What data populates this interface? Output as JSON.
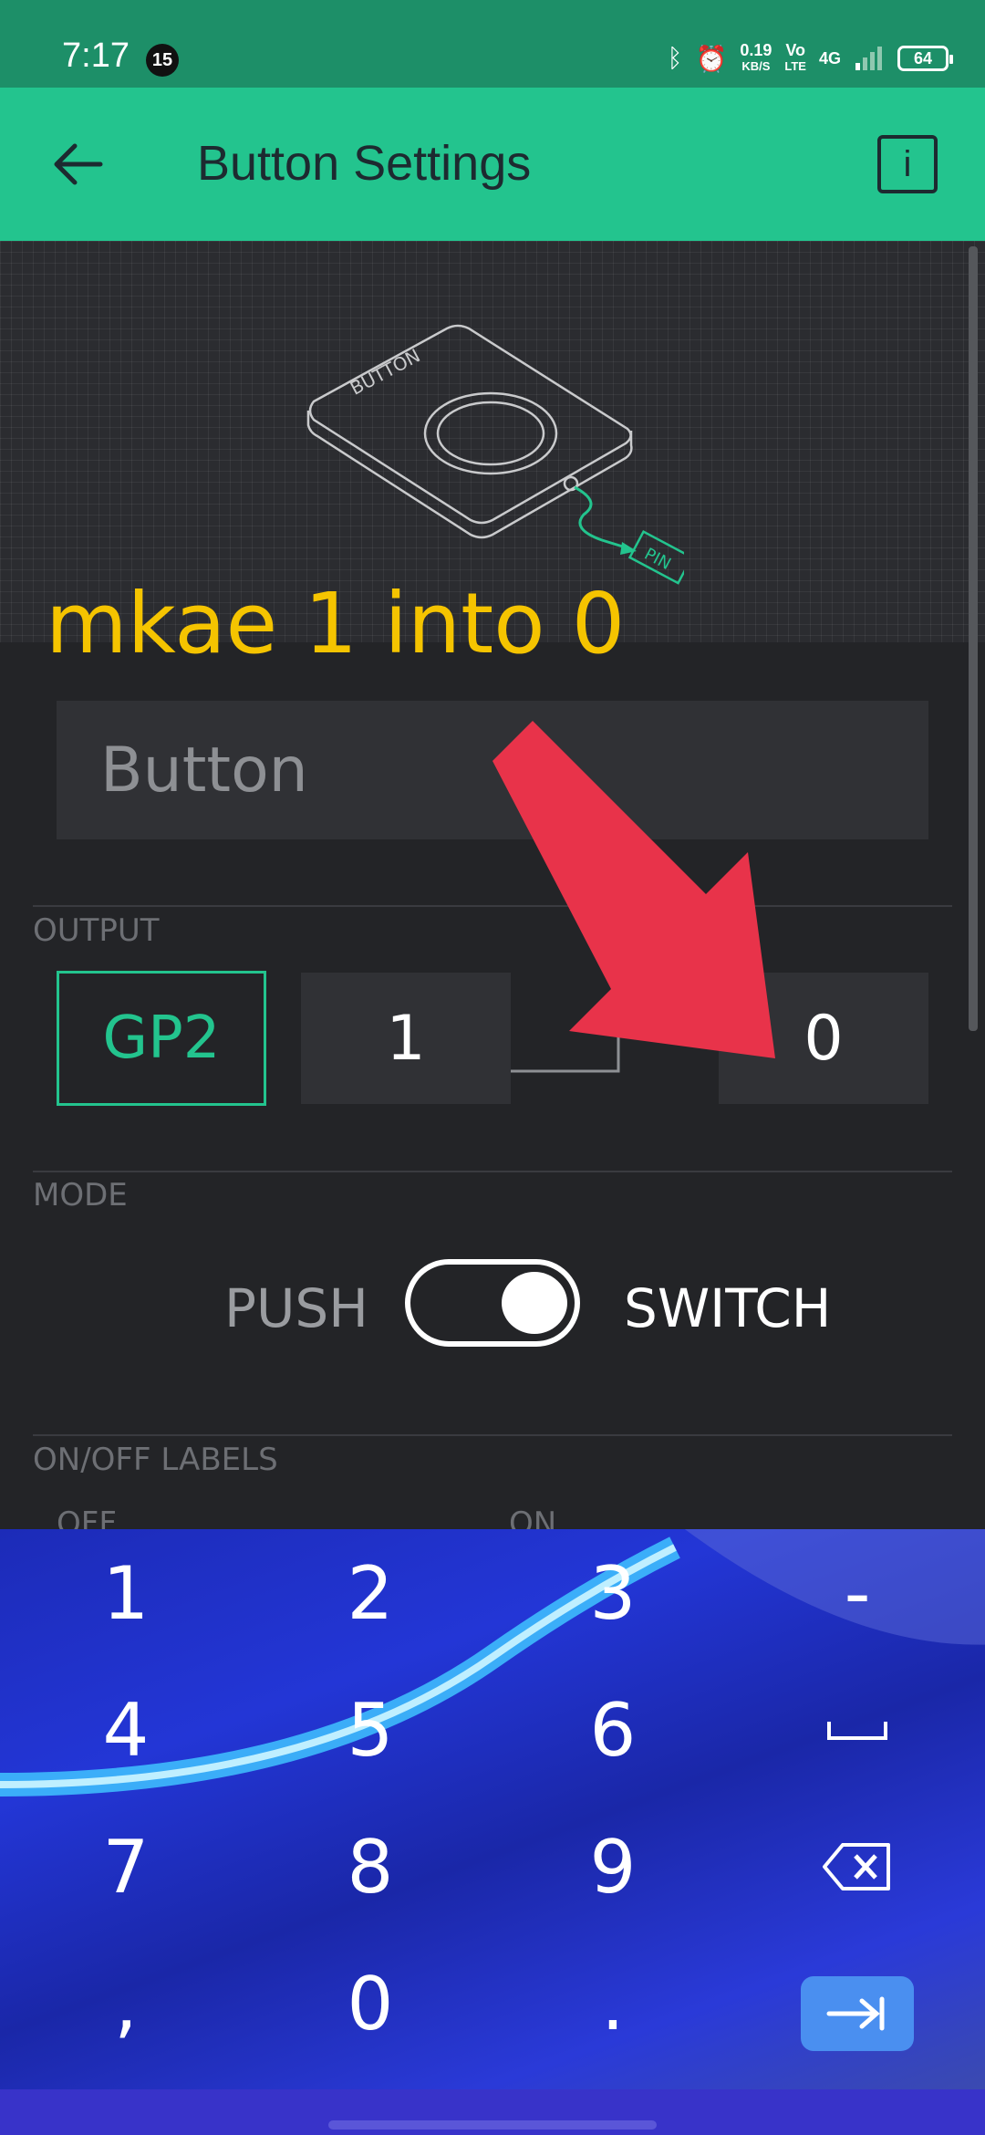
{
  "status_bar": {
    "time": "7:17",
    "notification_count": "15",
    "data_speed_value": "0.19",
    "data_speed_unit": "KB/S",
    "volte_top": "Vo",
    "volte_bottom": "LTE",
    "network": "4G",
    "battery": "64"
  },
  "app_bar": {
    "title": "Button Settings",
    "info_label": "i"
  },
  "preview": {
    "widget_label": "BUTTON",
    "pin_label": "PIN"
  },
  "annotation": {
    "text": "mkae 1 into 0",
    "text_color": "#f5c400",
    "arrow_color": "#e8334a"
  },
  "name_field": {
    "value": "Button"
  },
  "output": {
    "section_label": "OUTPUT",
    "pin": "GP2",
    "low_value": "1",
    "high_value": "0"
  },
  "mode": {
    "section_label": "MODE",
    "left_label": "PUSH",
    "right_label": "SWITCH",
    "selected": "SWITCH"
  },
  "onoff": {
    "section_label": "ON/OFF LABELS",
    "off_label": "OFF",
    "on_label": "ON"
  },
  "keyboard": {
    "rows": [
      [
        "1",
        "2",
        "3",
        "-"
      ],
      [
        "4",
        "5",
        "6",
        "space-icon"
      ],
      [
        "7",
        "8",
        "9",
        "backspace-icon"
      ],
      [
        ",",
        "0",
        ".",
        "tab-enter-icon"
      ]
    ]
  },
  "colors": {
    "accent": "#23c48e",
    "status_bar": "#1d8f68",
    "background": "#232427"
  }
}
